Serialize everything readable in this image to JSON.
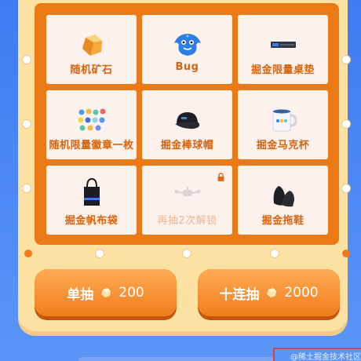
{
  "prizes": [
    {
      "label": "随机矿石",
      "icon": "ore-icon",
      "locked": false
    },
    {
      "label": "Bug",
      "icon": "bug-mascot-icon",
      "locked": false
    },
    {
      "label": "掘金限量桌垫",
      "icon": "desk-mat-icon",
      "locked": false
    },
    {
      "label": "随机限量徽章一枚",
      "icon": "badges-icon",
      "locked": false
    },
    {
      "label": "掘金棒球帽",
      "icon": "cap-icon",
      "locked": false
    },
    {
      "label": "掘金马克杯",
      "icon": "mug-icon",
      "locked": false
    },
    {
      "label": "掘金帆布袋",
      "icon": "tote-bag-icon",
      "locked": false
    },
    {
      "label": "再抽2次解锁",
      "icon": "locked-prize-icon",
      "locked": true
    },
    {
      "label": "掘金拖鞋",
      "icon": "slippers-icon",
      "locked": false
    }
  ],
  "buttons": {
    "single": {
      "label": "单抽",
      "cost": "200"
    },
    "ten": {
      "label": "十连抽",
      "cost": "2000"
    }
  },
  "watermark": "@稀土掘金技术社区",
  "colors": {
    "background": "#3f7bf2",
    "board": "#fbe2a3",
    "grid": "#ea7a15",
    "cell": "#fdf1ee",
    "label": "#d8630d",
    "button": "#f07d1c"
  }
}
